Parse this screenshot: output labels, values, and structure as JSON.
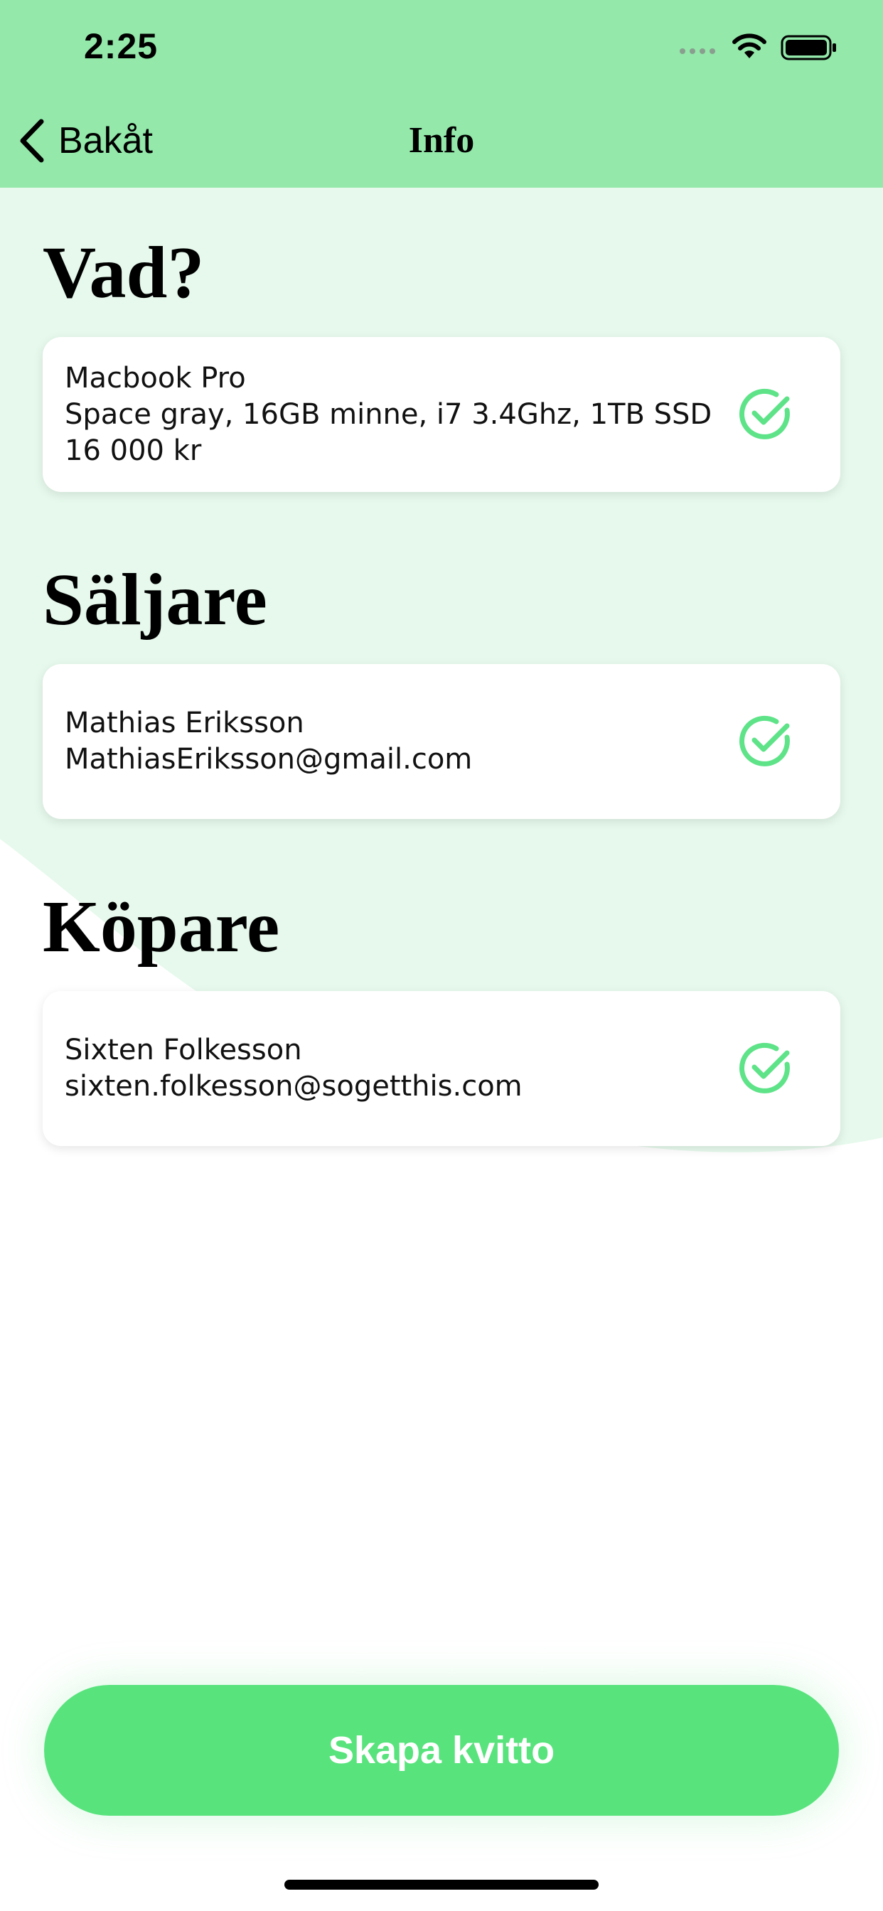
{
  "status_bar": {
    "time": "2:25"
  },
  "nav": {
    "back_label": "Bakåt",
    "title": "Info"
  },
  "sections": [
    {
      "title": "Vad?",
      "lines": [
        "Macbook Pro",
        "Space gray, 16GB minne, i7 3.4Ghz, 1TB SSD",
        "16 000 kr"
      ],
      "verified": true
    },
    {
      "title": "Säljare",
      "lines": [
        "Mathias Eriksson",
        "MathiasEriksson@gmail.com"
      ],
      "verified": true
    },
    {
      "title": "Köpare",
      "lines": [
        "Sixten Folkesson",
        "sixten.folkesson@sogetthis.com"
      ],
      "verified": true
    }
  ],
  "action": {
    "create_label": "Skapa kvitto"
  },
  "colors": {
    "header": "#93e8aa",
    "background_wave": "#e6f9ec",
    "accent": "#58e37d",
    "check": "#5ee388"
  },
  "icons": {
    "back": "chevron-left-icon",
    "verified": "check-circle-icon",
    "wifi": "wifi-icon",
    "battery": "battery-icon",
    "signal": "signal-icon"
  }
}
